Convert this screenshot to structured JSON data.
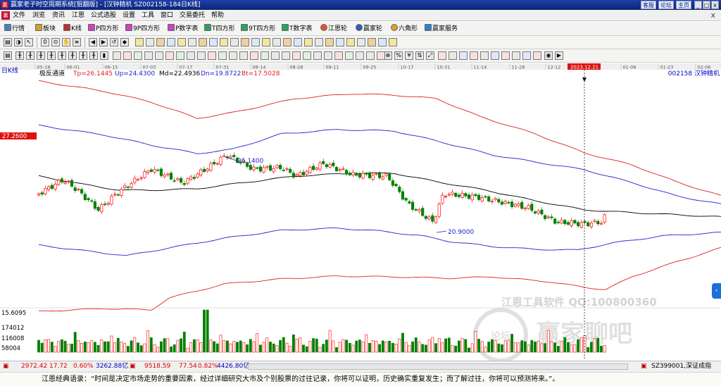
{
  "window": {
    "logo": "赢",
    "title": "赢家老子时空周期系统[狙翻版] - [汉钟精机  SZ002158-184日K线]",
    "buttons": [
      "客服",
      "论坛",
      "主页"
    ],
    "controls": [
      "_",
      "□",
      "x"
    ]
  },
  "menu": {
    "logo": "赢",
    "items": [
      "文件",
      "浏览",
      "资讯",
      "江恩",
      "公式选股",
      "设置",
      "工具",
      "窗口",
      "交易委托",
      "帮助"
    ],
    "close": "x"
  },
  "toolbar1": {
    "items": [
      "行情",
      "板块",
      "K线",
      "P四方形",
      "9P四方形",
      "P数字表",
      "T四方形",
      "9T四方形",
      "T数字表",
      "江恩轮",
      "赢家轮",
      "六角形",
      "赢家服务"
    ]
  },
  "toolbar2": {
    "glyphs": [
      "▤",
      "◑",
      "↖",
      "0",
      "⊙",
      "✋",
      "≡",
      "◀",
      "▶",
      "↺",
      "◆"
    ]
  },
  "toolbar3": {
    "glyphs": [
      "▤",
      "╫",
      "╫",
      "╫",
      "╫",
      "╫",
      "╫",
      "╫",
      "╫",
      "▮",
      "⊕",
      "%",
      "¥",
      "⇅",
      "⤢",
      "◉",
      "▶"
    ]
  },
  "chart": {
    "period_label": "日K线",
    "indicator": {
      "name": "极反通道",
      "items": [
        "Tp=26.1445",
        "Up=24.4300",
        "Md=22.4936",
        "Dn=19.8722",
        "Bt=17.5028"
      ]
    },
    "stock_label": "002158  汉钟精机",
    "date_ticks": [
      "05-18",
      "06-01",
      "06-15",
      "07-03",
      "07-17",
      "07-31",
      "08-14",
      "08-28",
      "09-11",
      "09-25",
      "10-17",
      "10-31",
      "11-14",
      "11-28",
      "12-12",
      "2023.12.21",
      "01-08",
      "01-23",
      "02-06"
    ],
    "price_marker": "27.2600",
    "high_label": "26.1400",
    "low_label": "20.9000",
    "volume_labels": [
      "15.6095",
      "174012",
      "116008",
      "58004"
    ],
    "watermark": {
      "title": "江恩工具软件  QQ:100800360",
      "brand": "赢家聊吧",
      "logo": "论坛"
    },
    "colors": {
      "up": "#ff0000",
      "down": "#008000",
      "tp_bt": "#e02020",
      "up_dn": "#2020d0",
      "md": "#000000"
    }
  },
  "status": {
    "index1": "2972.42",
    "index1_change": "17.72",
    "index1_pct": "0.60%",
    "index1_amount": "3262.88亿",
    "index2": "9518.59",
    "index2_change": "77.54",
    "index2_pct": "0.82%",
    "index2_amount": "4426.80亿",
    "ticker": "SZ399001,深证成指"
  },
  "footer": {
    "quote": "江恩经典语录：“时间是决定市场走势的重要因素，经过详细研究大市及个别股票的过往记录，你将可以证明，历史确实重复发生；而了解过往，你将可以预测将来。”。"
  }
}
